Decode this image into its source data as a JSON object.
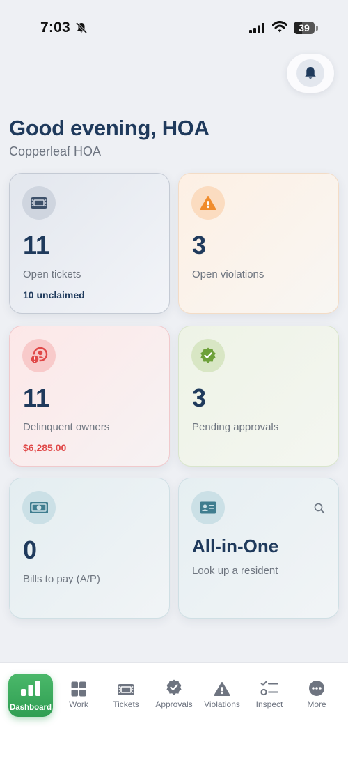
{
  "status_bar": {
    "time": "7:03",
    "battery": "39",
    "icons": [
      "bell-slash-icon",
      "signal-icon",
      "wifi-icon",
      "battery-icon"
    ]
  },
  "header": {
    "greeting": "Good evening, HOA",
    "org_name": "Copperleaf HOA",
    "notification_icon": "bell-icon"
  },
  "cards": {
    "tickets": {
      "value": "11",
      "label": "Open tickets",
      "sub": "10 unclaimed",
      "icon": "ticket-icon",
      "accent": "#4b6079"
    },
    "violations": {
      "value": "3",
      "label": "Open violations",
      "icon": "warning-icon",
      "accent": "#f08c2c"
    },
    "delinquent": {
      "value": "11",
      "label": "Delinquent owners",
      "sub": "$6,285.00",
      "icon": "user-alert-icon",
      "accent": "#e04848"
    },
    "approvals": {
      "value": "3",
      "label": "Pending approvals",
      "icon": "badge-check-icon",
      "accent": "#6ea13a"
    },
    "bills": {
      "value": "0",
      "label": "Bills to pay (A/P)",
      "icon": "cash-icon",
      "accent": "#3f7d8f"
    },
    "all_in_one": {
      "title": "All-in-One",
      "label": "Look up a resident",
      "icon": "id-card-icon",
      "search_icon": "search-icon",
      "accent": "#3f7d8f"
    }
  },
  "tab_bar": {
    "active": "Dashboard",
    "items": [
      {
        "label": "Dashboard",
        "icon": "bar-chart-icon"
      },
      {
        "label": "Work",
        "icon": "grid-icon"
      },
      {
        "label": "Tickets",
        "icon": "ticket-icon"
      },
      {
        "label": "Approvals",
        "icon": "badge-check-icon"
      },
      {
        "label": "Violations",
        "icon": "warning-icon"
      },
      {
        "label": "Inspect",
        "icon": "checklist-icon"
      },
      {
        "label": "More",
        "icon": "more-icon"
      }
    ]
  }
}
